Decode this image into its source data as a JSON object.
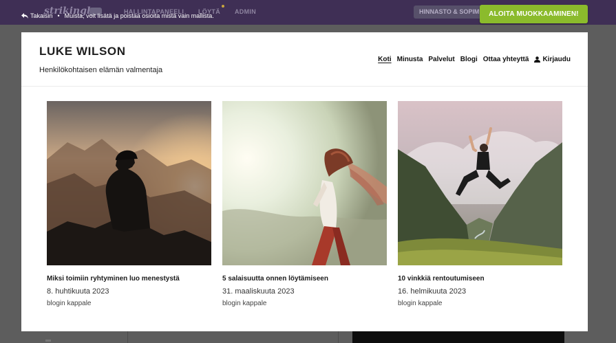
{
  "editor": {
    "logo": "strikingly",
    "nav_dim": [
      "HALLINTAPANEELI",
      "LÖYTÄ",
      "ADMIN"
    ],
    "pricing_label": "HINNASTO & SOPIMUKSET",
    "back_label": "Takaisin",
    "separator": "•",
    "note": "Muista, voit lisätä ja poistaa osioita mistä vain mallista.",
    "start_button": "ALOITA MUOKKAAMINEN!",
    "accent_color": "#8bbb2c",
    "bar_color": "#3f2f55"
  },
  "site": {
    "title": "LUKE WILSON",
    "tagline": "Henkilökohtaisen elämän valmentaja",
    "nav": [
      "Koti",
      "Minusta",
      "Palvelut",
      "Blogi",
      "Ottaa yhteyttä"
    ],
    "login": "Kirjaudu"
  },
  "posts": [
    {
      "title": "Miksi toimiin ryhtyminen luo menestystä",
      "date": "8. huhtikuuta 2023",
      "excerpt": "blogin kappale",
      "image": "silhouette-on-mountain-sunset"
    },
    {
      "title": "5 salaisuutta onnen löytämiseen",
      "date": "31. maaliskuuta 2023",
      "excerpt": "blogin kappale",
      "image": "woman-with-scarf-in-sunlight"
    },
    {
      "title": "10 vinkkiä rentoutumiseen",
      "date": "16. helmikuuta 2023",
      "excerpt": "blogin kappale",
      "image": "woman-jumping-in-mountain-valley"
    }
  ]
}
